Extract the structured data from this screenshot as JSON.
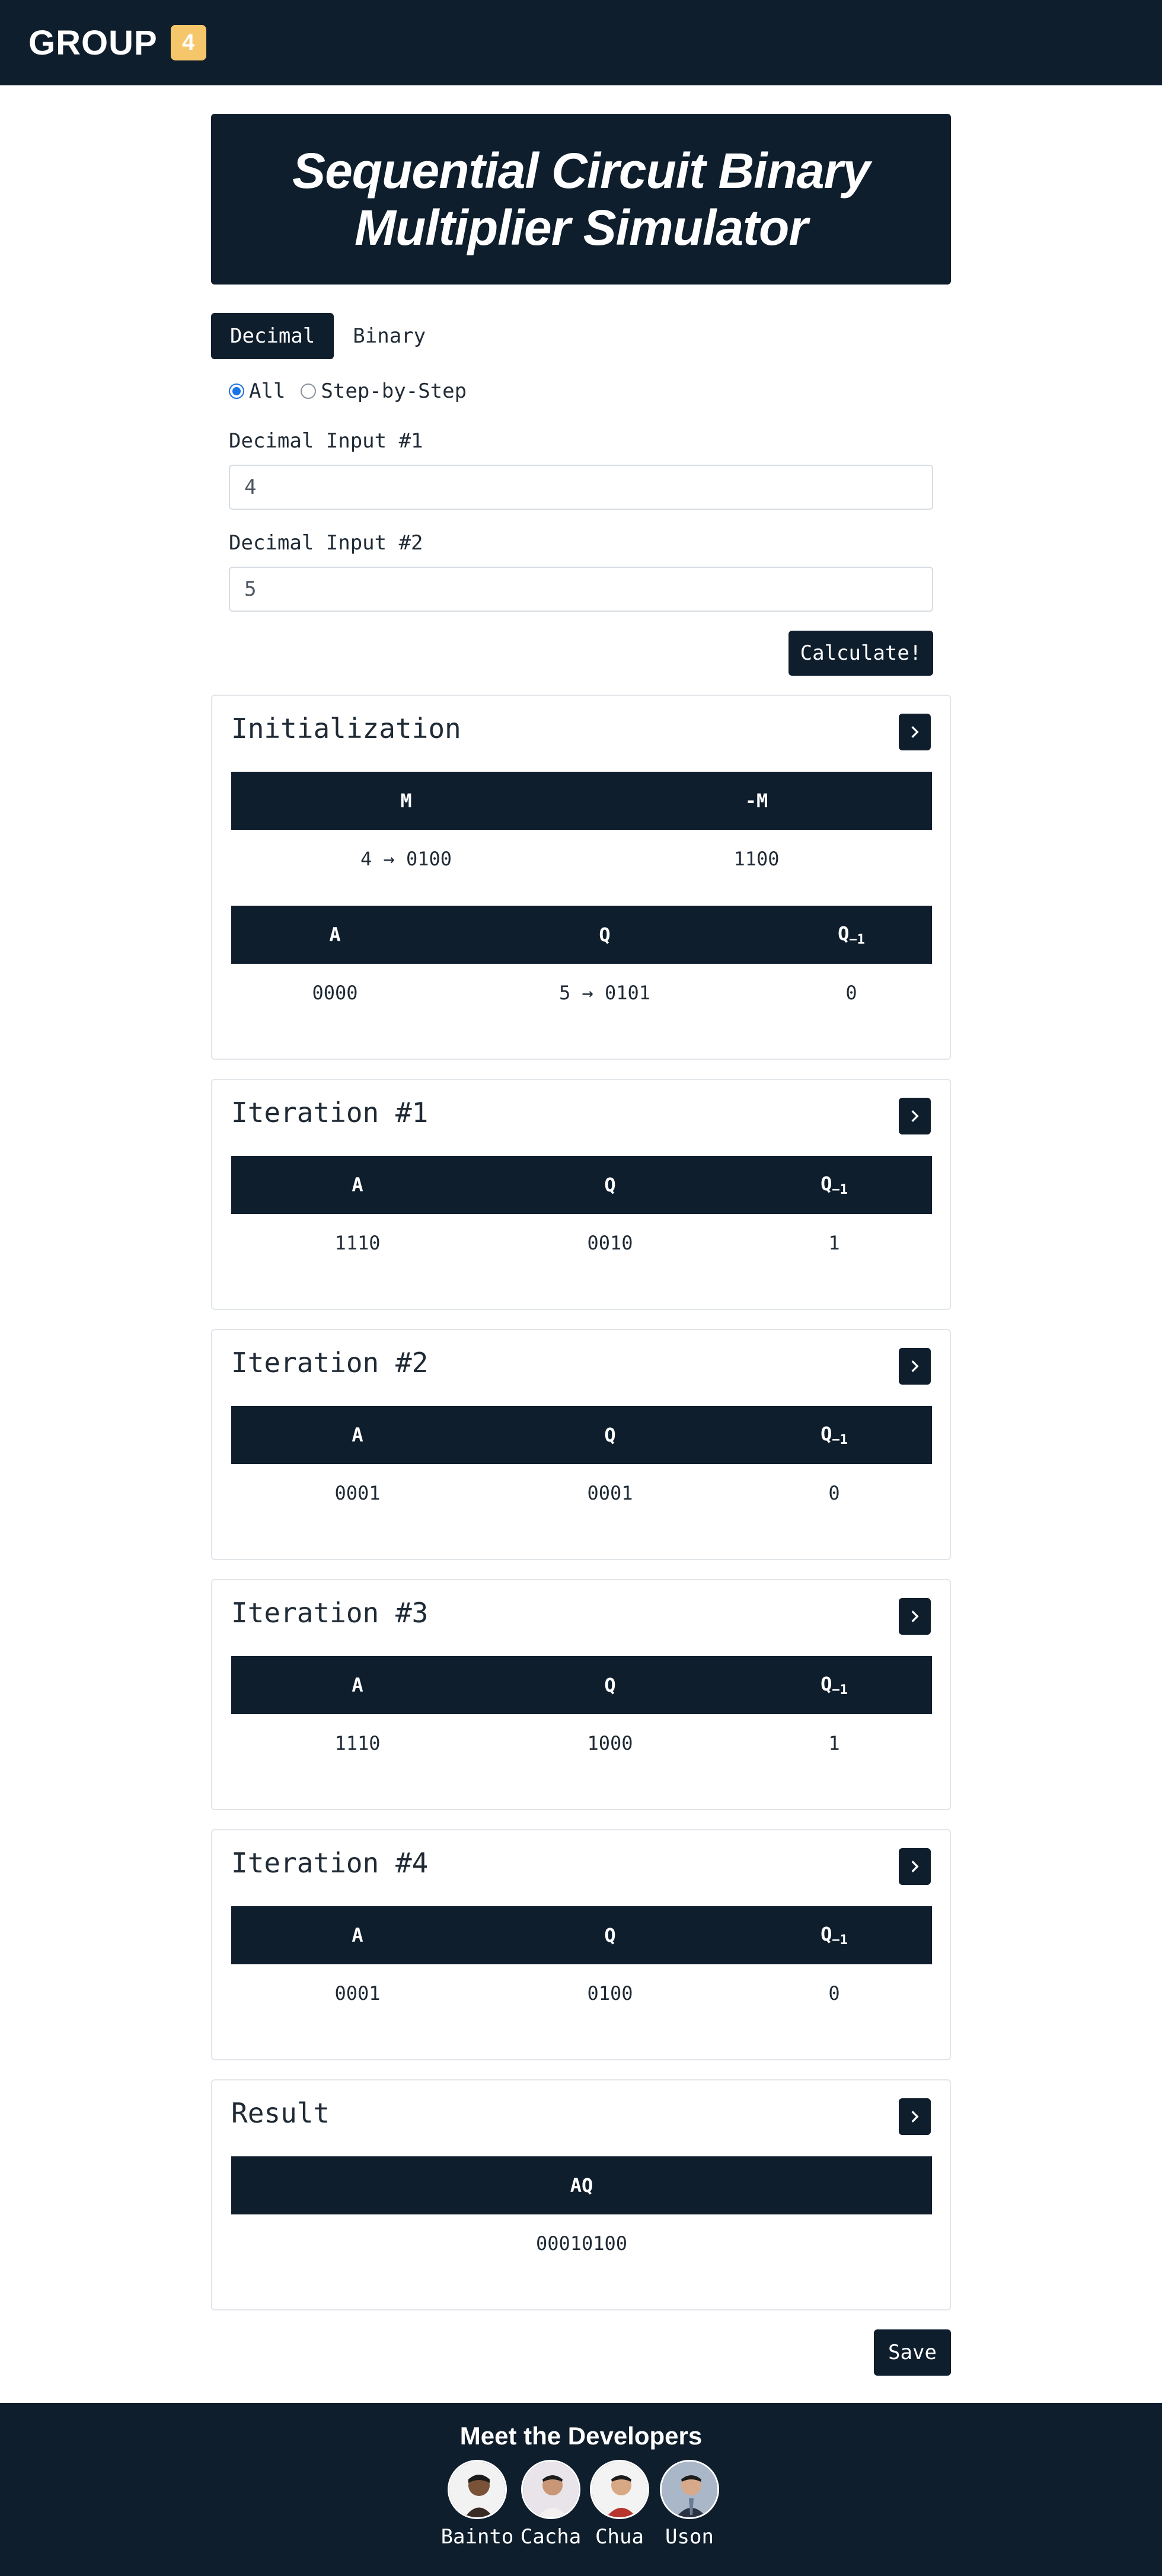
{
  "header": {
    "brand": "GROUP",
    "badge": "4"
  },
  "hero": {
    "title_line1": "Sequential Circuit Binary",
    "title_line2": "Multiplier Simulator"
  },
  "tabs": [
    {
      "label": "Decimal"
    },
    {
      "label": "Binary"
    }
  ],
  "mode": {
    "options": [
      {
        "label": "All",
        "checked": true
      },
      {
        "label": "Step-by-Step",
        "checked": false
      }
    ]
  },
  "inputs": [
    {
      "label": "Decimal Input #1",
      "value": "4"
    },
    {
      "label": "Decimal Input #2",
      "value": "5"
    }
  ],
  "calculate_label": "Calculate!",
  "init": {
    "title": "Initialization",
    "m_headers": [
      "M",
      "-M"
    ],
    "m_values": [
      "4 → 0100",
      "1100"
    ],
    "aq_headers": {
      "a": "A",
      "q": "Q",
      "q1": "Q",
      "q1_sub": "−1"
    },
    "aq_values": [
      "0000",
      "5 → 0101",
      "0"
    ]
  },
  "iterations": [
    {
      "title": "Iteration #1",
      "headers": {
        "a": "A",
        "q": "Q",
        "q1": "Q",
        "q1_sub": "−1"
      },
      "values": [
        "1110",
        "0010",
        "1"
      ]
    },
    {
      "title": "Iteration #2",
      "headers": {
        "a": "A",
        "q": "Q",
        "q1": "Q",
        "q1_sub": "−1"
      },
      "values": [
        "0001",
        "0001",
        "0"
      ]
    },
    {
      "title": "Iteration #3",
      "headers": {
        "a": "A",
        "q": "Q",
        "q1": "Q",
        "q1_sub": "−1"
      },
      "values": [
        "1110",
        "1000",
        "1"
      ]
    },
    {
      "title": "Iteration #4",
      "headers": {
        "a": "A",
        "q": "Q",
        "q1": "Q",
        "q1_sub": "−1"
      },
      "values": [
        "0001",
        "0100",
        "0"
      ]
    }
  ],
  "result": {
    "title": "Result",
    "header": "AQ",
    "value": "00010100"
  },
  "save_label": "Save",
  "footer": {
    "heading": "Meet the Developers",
    "developers": [
      {
        "name": "Bainto"
      },
      {
        "name": "Cacha"
      },
      {
        "name": "Chua"
      },
      {
        "name": "Uson"
      }
    ]
  },
  "colors": {
    "navy": "#0f1e2d",
    "accent": "#f6c76a",
    "radio": "#1a73e8"
  },
  "icons": {
    "expand": "chevron-right-icon"
  }
}
